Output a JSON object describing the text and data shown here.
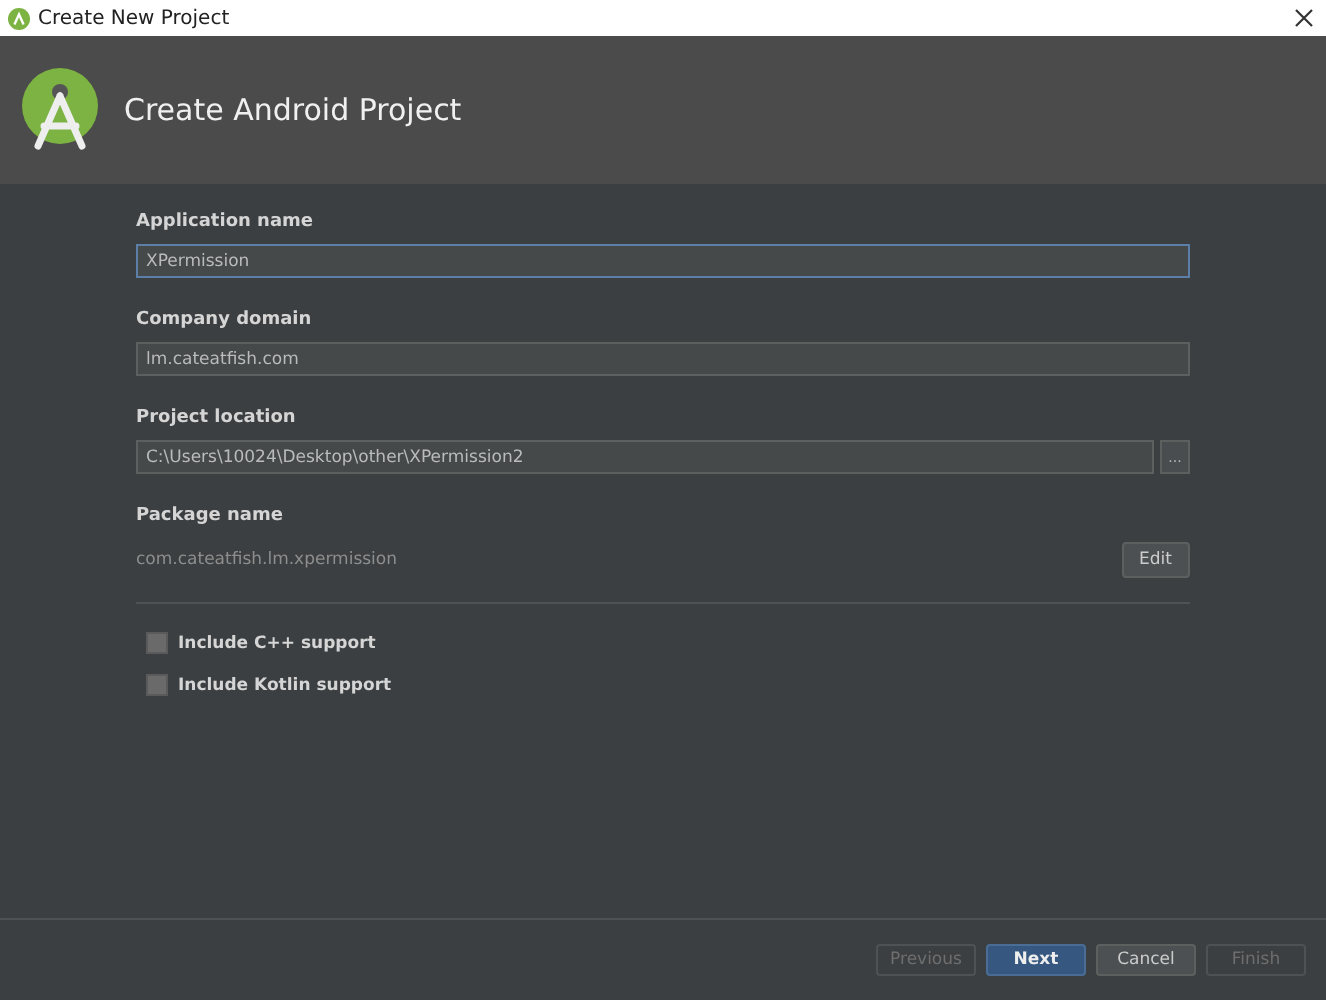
{
  "window": {
    "title": "Create New Project"
  },
  "header": {
    "title": "Create Android Project"
  },
  "fields": [
    {
      "label": "Application name",
      "value": "XPermission",
      "focused": true,
      "kind": "text"
    },
    {
      "label": "Company domain",
      "value": "lm.cateatfish.com",
      "focused": false,
      "kind": "text"
    },
    {
      "label": "Project location",
      "value": "C:\\Users\\10024\\Desktop\\other\\XPermission2",
      "focused": false,
      "kind": "browse",
      "browse_label": "..."
    }
  ],
  "package": {
    "label": "Package name",
    "value": "com.cateatfish.lm.xpermission",
    "button": "Edit"
  },
  "options": [
    {
      "label": "Include C++ support",
      "checked": false
    },
    {
      "label": "Include Kotlin support",
      "checked": false
    }
  ],
  "buttons": [
    {
      "label": "Previous",
      "disabled": true,
      "default": false
    },
    {
      "label": "Next",
      "disabled": false,
      "default": true
    },
    {
      "label": "Cancel",
      "disabled": false,
      "default": false
    },
    {
      "label": "Finish",
      "disabled": true,
      "default": false
    }
  ]
}
